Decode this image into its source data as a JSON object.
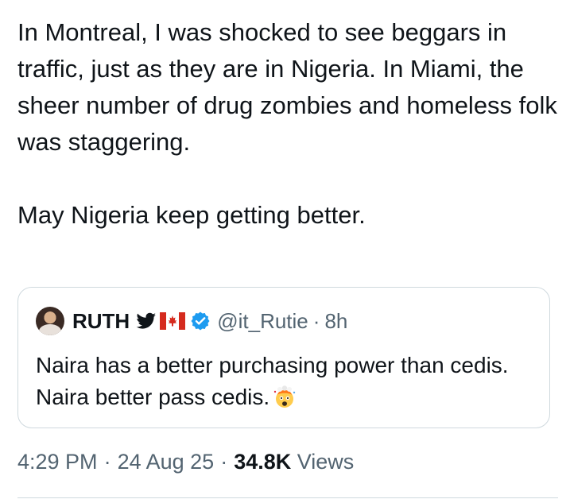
{
  "tweet": {
    "paragraphs": [
      "In Montreal, I was shocked to see beggars in traffic, just as they are in Nigeria. In Miami, the sheer number of drug zombies and homeless folk was staggering.",
      "May Nigeria keep getting better."
    ]
  },
  "quote": {
    "author_name": "RUTH",
    "handle": "@it_Rutie",
    "separator": "·",
    "time": "8h",
    "text": "Naira has a better purchasing power than cedis. Naira better pass cedis.",
    "emoji": "exploding-head-emoji",
    "badges": [
      "bird-icon",
      "canada-flag-icon",
      "verified-icon"
    ]
  },
  "meta": {
    "time": "4:29 PM",
    "separator": "·",
    "date": "24 Aug 25",
    "views_count": "34.8K",
    "views_label": "Views"
  },
  "colors": {
    "text": "#0f1419",
    "secondary": "#536471",
    "border": "#cfd9de",
    "verified": "#1d9bf0"
  }
}
